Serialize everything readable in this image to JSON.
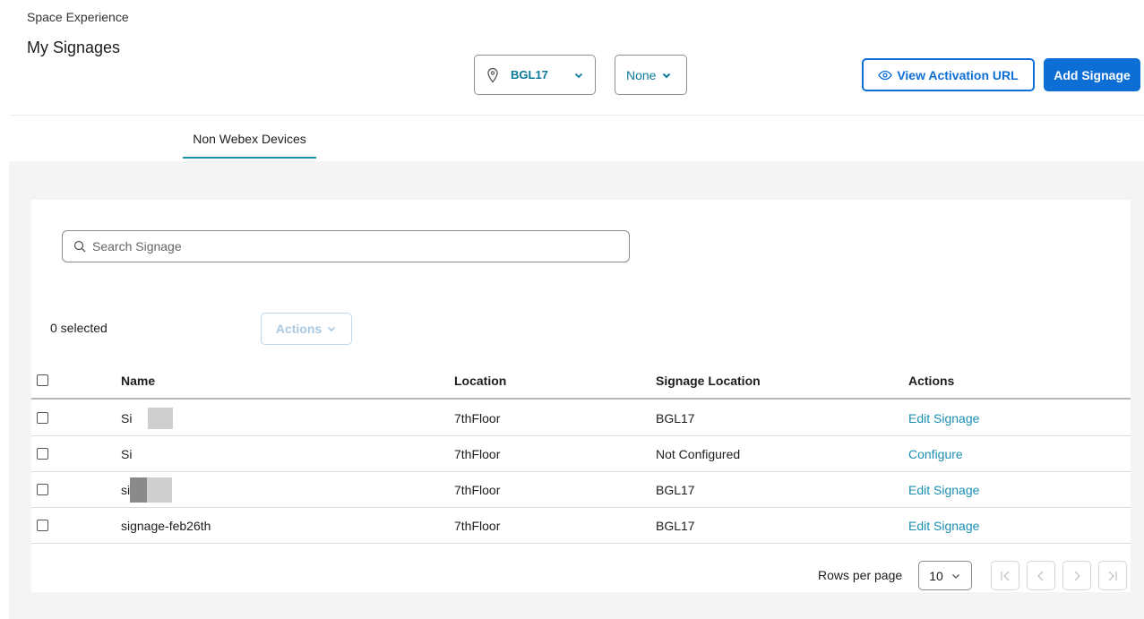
{
  "header": {
    "eyebrow": "Space Experience",
    "title": "My Signages"
  },
  "filters": {
    "location": {
      "icon": "location-pin-icon",
      "value": "BGL17"
    },
    "secondary": {
      "value": "None"
    }
  },
  "buttons": {
    "view_activation_url": "View Activation URL",
    "add_signage": "Add Signage"
  },
  "tabs": [
    {
      "label": "Non Webex Devices",
      "active": true
    }
  ],
  "search": {
    "placeholder": "Search Signage",
    "value": ""
  },
  "toolbar": {
    "selected_count": "0 selected",
    "actions_label": "Actions"
  },
  "table": {
    "columns": [
      "Name",
      "Location",
      "Signage Location",
      "Actions"
    ],
    "rows": [
      {
        "name": "Si",
        "location": "7thFloor",
        "signage_location": "BGL17",
        "action": "Edit Signage"
      },
      {
        "name": "Si",
        "location": "7thFloor",
        "signage_location": "Not Configured",
        "action": "Configure"
      },
      {
        "name": "si",
        "location": "7thFloor",
        "signage_location": "BGL17",
        "action": "Edit Signage"
      },
      {
        "name": "signage-feb26th",
        "location": "7thFloor",
        "signage_location": "BGL17",
        "action": "Edit Signage"
      }
    ]
  },
  "pagination": {
    "rows_per_page_label": "Rows per page",
    "rows_per_page": "10",
    "controls": [
      "first-page-icon",
      "prev-page-icon",
      "next-page-icon",
      "last-page-icon"
    ]
  },
  "colors": {
    "primary": "#0d6ed6",
    "link": "#1b8fb0",
    "tab_underline": "#1b8fb0",
    "content_bg": "#f4f4f4"
  }
}
